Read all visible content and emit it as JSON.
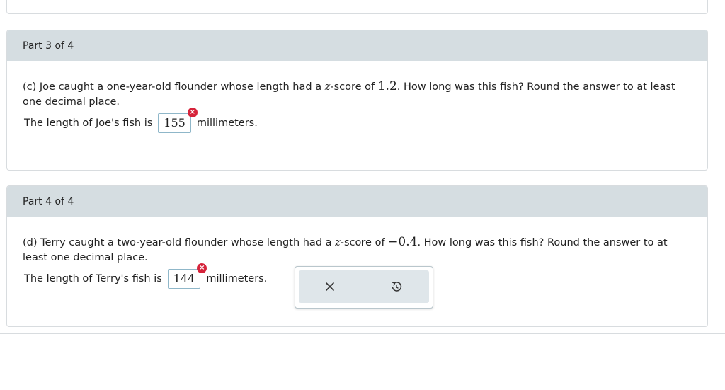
{
  "part3": {
    "label": "Part 3 of 4",
    "question_prefix": "(c) Joe caught a one-year-old flounder whose length had a ",
    "z_var": "z",
    "question_mid": "-score of ",
    "z_value": "1.2",
    "question_suffix": ". How long was this fish? Round the answer to at least one decimal place.",
    "answer_prefix": "The length of Joe's fish is",
    "answer_value": "155",
    "answer_suffix": "millimeters."
  },
  "part4": {
    "label": "Part 4 of 4",
    "question_prefix": "(d) Terry caught a two-year-old flounder whose length had a ",
    "z_var": "z",
    "question_mid": "-score of ",
    "z_value": "−0.4",
    "question_suffix": ". How long was this fish? Round the answer to at least one decimal place.",
    "answer_prefix": "The length of Terry's fish is",
    "answer_value": "144",
    "answer_suffix": "millimeters."
  },
  "incorrect_badge_symbol": "×",
  "icons": {
    "clear": "close-icon",
    "reset": "undo-icon",
    "incorrect": "incorrect-x-icon"
  },
  "colors": {
    "header_bg": "#d5dde1",
    "incorrect": "#d6243b",
    "input_border": "#8fb7c9"
  }
}
